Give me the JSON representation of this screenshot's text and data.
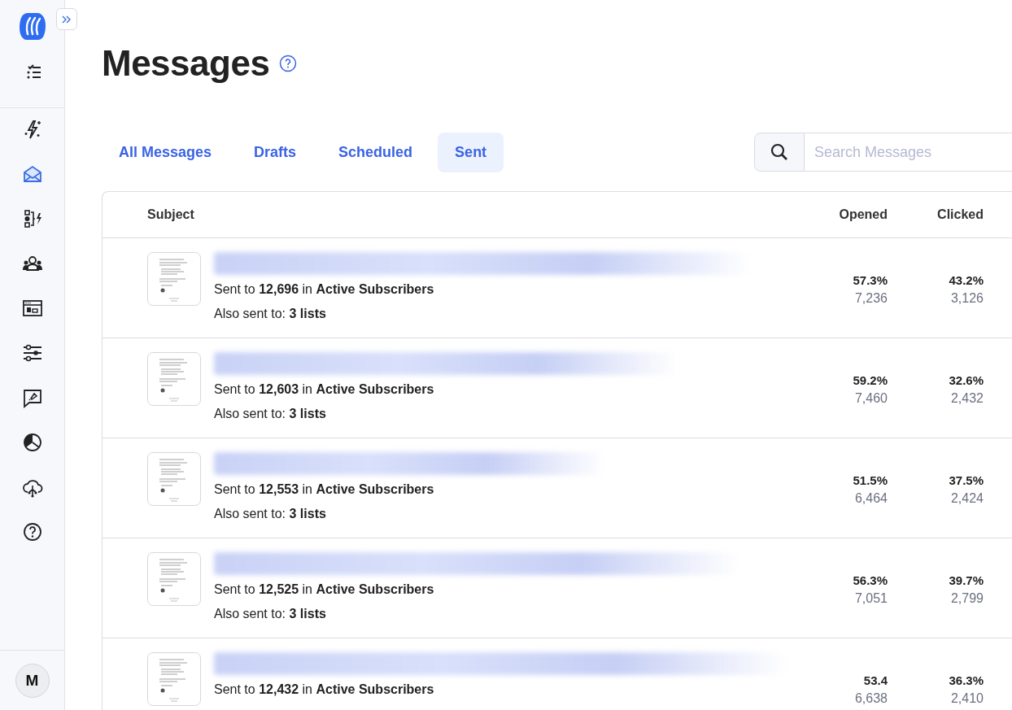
{
  "sidebar": {
    "items": [
      {
        "kind": "checklist",
        "selected": false
      },
      {
        "kind": "sparkle-bolt",
        "selected": false
      },
      {
        "kind": "envelope",
        "selected": true
      },
      {
        "kind": "automation",
        "selected": false
      },
      {
        "kind": "people",
        "selected": false
      },
      {
        "kind": "layout",
        "selected": false
      },
      {
        "kind": "sliders",
        "selected": false
      },
      {
        "kind": "chat",
        "selected": false
      },
      {
        "kind": "pie",
        "selected": false
      },
      {
        "kind": "cloud",
        "selected": false
      },
      {
        "kind": "help",
        "selected": false
      }
    ],
    "avatar": "M"
  },
  "page": {
    "title": "Messages"
  },
  "tabs": [
    {
      "label": "All Messages",
      "selected": false
    },
    {
      "label": "Drafts",
      "selected": false
    },
    {
      "label": "Scheduled",
      "selected": false
    },
    {
      "label": "Sent",
      "selected": true
    }
  ],
  "search": {
    "placeholder": "Search Messages"
  },
  "table": {
    "columns": [
      "Subject",
      "Opened",
      "Clicked"
    ],
    "rows": [
      {
        "sent": "Sent to **12,696** in **Active Subscribers**",
        "also_sent": "Also sent to: **3 lists**",
        "opened_rate": "57.3%",
        "opened_count": "7,236",
        "clicked_rate": "43.2%",
        "clicked_count": "3,126"
      },
      {
        "sent": "Sent to **12,603** in **Active Subscribers**",
        "also_sent": "Also sent to: **3 lists**",
        "opened_rate": "59.2%",
        "opened_count": "7,460",
        "clicked_rate": "32.6%",
        "clicked_count": "2,432"
      },
      {
        "sent": "Sent to **12,553** in **Active Subscribers**",
        "also_sent": "Also sent to: **3 lists**",
        "opened_rate": "51.5%",
        "opened_count": "6,464",
        "clicked_rate": "37.5%",
        "clicked_count": "2,424"
      },
      {
        "sent": "Sent to **12,525** in **Active Subscribers**",
        "also_sent": "Also sent to: **3 lists**",
        "opened_rate": "56.3%",
        "opened_count": "7,051",
        "clicked_rate": "39.7%",
        "clicked_count": "2,799"
      },
      {
        "sent": "Sent to **12,432** in **Active Subscribers**",
        "opened_rate": "53.4",
        "opened_count": "6,638",
        "clicked_rate": "36.3%",
        "clicked_count": "2,410"
      }
    ]
  }
}
